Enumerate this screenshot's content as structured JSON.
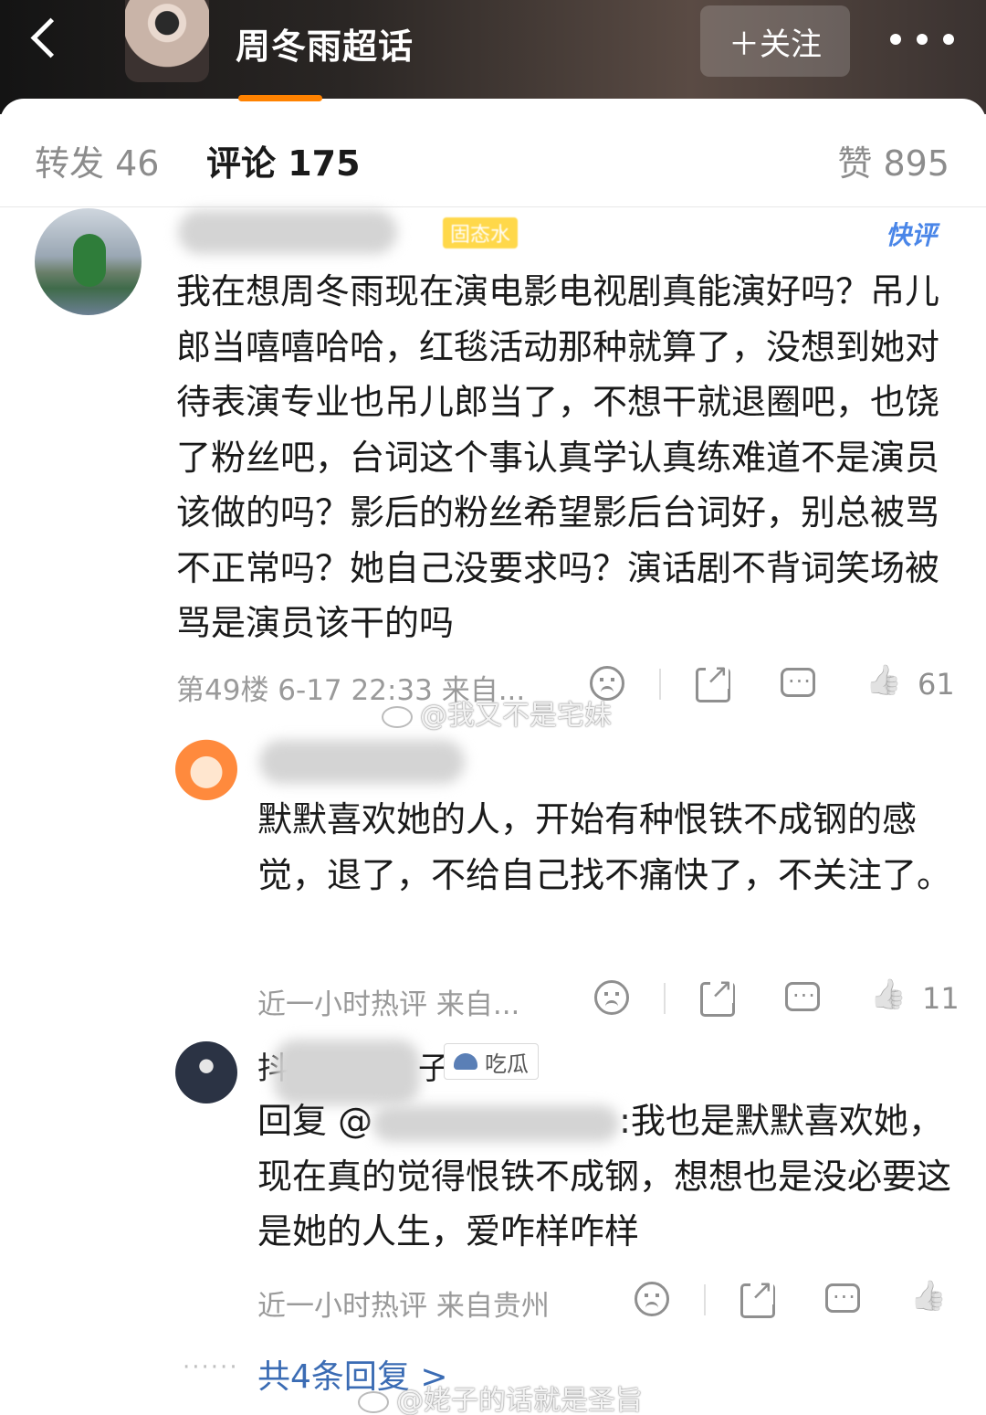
{
  "topbar": {
    "title": "周冬雨超话",
    "follow_label": "＋关注"
  },
  "tabs": {
    "forward": "转发 46",
    "comments": "评论 175",
    "likes": "赞 895"
  },
  "colors": {
    "accent_orange": "#ff8200",
    "link_blue": "#3b6cb4",
    "meta_gray": "#9a9a9a"
  },
  "main_comment": {
    "badge": "固态水",
    "hot_tag": "快评",
    "text": "我在想周冬雨现在演电影电视剧真能演好吗？吊儿郎当嘻嘻哈哈，红毯活动那种就算了，没想到她对待表演专业也吊儿郎当了，不想干就退圈吧，也饶了粉丝吧，台词这个事认真学认真练难道不是演员该做的吗？影后的粉丝希望影后台词好，别总被骂不正常吗？她自己没要求吗？演话剧不背词笑场被骂是演员该干的吗",
    "meta": "第49楼 6-17 22:33 来自...",
    "likes": "61"
  },
  "reply1": {
    "text": "默默喜欢她的人，开始有种恨铁不成钢的感觉，退了，不给自己找不痛快了，不关注了。",
    "meta": "近一小时热评 来自...",
    "likes": "11"
  },
  "reply2": {
    "name_visible_start": "抖",
    "name_visible_end": "子",
    "badge": "吃瓜",
    "reply_prefix": "回复 @",
    "text_after": ":我也是默默喜欢她，现在真的觉得恨铁不成钢，想想也是没必要这是她的人生，爱咋样咋样",
    "meta": "近一小时热评 来自贵州"
  },
  "more_replies": "共4条回复 >",
  "watermarks": {
    "wm1": "@我又不是宅妹",
    "wm2": "@姥子的话就是圣旨"
  }
}
